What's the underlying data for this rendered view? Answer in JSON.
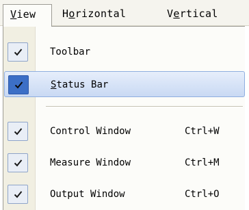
{
  "menubar": {
    "view": {
      "pre": "",
      "mnemonic": "V",
      "post": "iew"
    },
    "horizontal": {
      "pre": "H",
      "mnemonic": "o",
      "post": "rizontal"
    },
    "vertical": {
      "pre": "V",
      "mnemonic": "e",
      "post": "rtical"
    }
  },
  "menu": {
    "items": [
      {
        "label": "Toolbar",
        "checked": true,
        "shortcut": ""
      },
      {
        "label_pre": "",
        "label_mnemonic": "S",
        "label_post": "tatus Bar",
        "checked": true,
        "highlighted": true,
        "shortcut": ""
      },
      {
        "label": "Control Window",
        "checked": true,
        "shortcut": "Ctrl+W"
      },
      {
        "label": "Measure Window",
        "checked": true,
        "shortcut": "Ctrl+M"
      },
      {
        "label": "Output Window",
        "checked": true,
        "shortcut": "Ctrl+O"
      }
    ]
  },
  "colors": {
    "highlight_check_bg": "#3c6fc6",
    "check_bg": "#e9eef6",
    "menubar_bg": "#f5f4ee"
  }
}
